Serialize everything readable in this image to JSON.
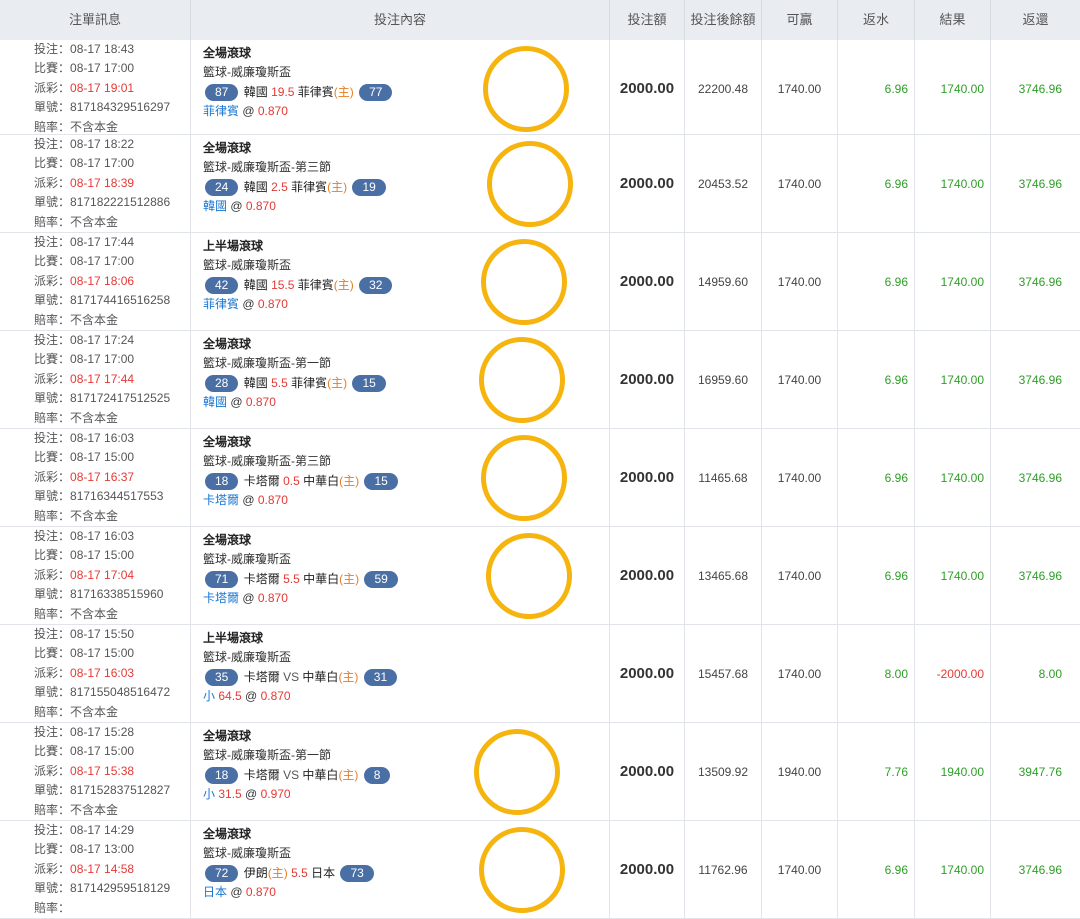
{
  "headers": [
    "注單訊息",
    "投注內容",
    "投注額",
    "投注後餘額",
    "可贏",
    "返水",
    "結果",
    "返還"
  ],
  "labels": {
    "bet": "投注：",
    "match": "比賽：",
    "settle": "派彩：",
    "order": "單號：",
    "odds_rate": "賠率："
  },
  "rows": [
    {
      "bet": "08-17 18:43",
      "match": "08-17 17:00",
      "settle": "08-17 19:01",
      "order": "817184329516297",
      "odds_rate": "不含本金",
      "title": "全場滾球",
      "league": "籃球-威廉瓊斯盃",
      "left_score": "87",
      "team1": "韓國",
      "handicap": "19.5",
      "team2": "菲律賓",
      "home": "(主)",
      "right_score": "77",
      "pick": "菲律賓",
      "pick_odds": "0.870",
      "amount": "2000.00",
      "balance": "22200.48",
      "win": "1740.00",
      "rebate": "6.96",
      "result": "1740.00",
      "return": "3746.96"
    },
    {
      "bet": "08-17 18:22",
      "match": "08-17 17:00",
      "settle": "08-17 18:39",
      "order": "817182221512886",
      "odds_rate": "不含本金",
      "title": "全場滾球",
      "league": "籃球-威廉瓊斯盃-第三節",
      "left_score": "24",
      "team1": "韓國",
      "handicap": "2.5",
      "team2": "菲律賓",
      "home": "(主)",
      "right_score": "19",
      "pick": "韓國",
      "pick_odds": "0.870",
      "amount": "2000.00",
      "balance": "20453.52",
      "win": "1740.00",
      "rebate": "6.96",
      "result": "1740.00",
      "return": "3746.96"
    },
    {
      "bet": "08-17 17:44",
      "match": "08-17 17:00",
      "settle": "08-17 18:06",
      "order": "817174416516258",
      "odds_rate": "不含本金",
      "title": "上半場滾球",
      "league": "籃球-威廉瓊斯盃",
      "left_score": "42",
      "team1": "韓國",
      "handicap": "15.5",
      "team2": "菲律賓",
      "home": "(主)",
      "right_score": "32",
      "pick": "菲律賓",
      "pick_odds": "0.870",
      "amount": "2000.00",
      "balance": "14959.60",
      "win": "1740.00",
      "rebate": "6.96",
      "result": "1740.00",
      "return": "3746.96"
    },
    {
      "bet": "08-17 17:24",
      "match": "08-17 17:00",
      "settle": "08-17 17:44",
      "order": "817172417512525",
      "odds_rate": "不含本金",
      "title": "全場滾球",
      "league": "籃球-威廉瓊斯盃-第一節",
      "left_score": "28",
      "team1": "韓國",
      "handicap": "5.5",
      "team2": "菲律賓",
      "home": "(主)",
      "right_score": "15",
      "pick": "韓國",
      "pick_odds": "0.870",
      "amount": "2000.00",
      "balance": "16959.60",
      "win": "1740.00",
      "rebate": "6.96",
      "result": "1740.00",
      "return": "3746.96"
    },
    {
      "bet": "08-17 16:03",
      "match": "08-17 15:00",
      "settle": "08-17 16:37",
      "order": "81716344517553",
      "odds_rate": "不含本金",
      "title": "全場滾球",
      "league": "籃球-威廉瓊斯盃-第三節",
      "left_score": "18",
      "team1": "卡塔爾",
      "handicap": "0.5",
      "team2": "中華白",
      "home": "(主)",
      "right_score": "15",
      "pick": "卡塔爾",
      "pick_odds": "0.870",
      "amount": "2000.00",
      "balance": "11465.68",
      "win": "1740.00",
      "rebate": "6.96",
      "result": "1740.00",
      "return": "3746.96"
    },
    {
      "bet": "08-17 16:03",
      "match": "08-17 15:00",
      "settle": "08-17 17:04",
      "order": "81716338515960",
      "odds_rate": "不含本金",
      "title": "全場滾球",
      "league": "籃球-威廉瓊斯盃",
      "left_score": "71",
      "team1": "卡塔爾",
      "handicap": "5.5",
      "team2": "中華白",
      "home": "(主)",
      "right_score": "59",
      "pick": "卡塔爾",
      "pick_odds": "0.870",
      "amount": "2000.00",
      "balance": "13465.68",
      "win": "1740.00",
      "rebate": "6.96",
      "result": "1740.00",
      "return": "3746.96"
    },
    {
      "bet": "08-17 15:50",
      "match": "08-17 15:00",
      "settle": "08-17 16:03",
      "order": "817155048516472",
      "odds_rate": "不含本金",
      "title": "上半場滾球",
      "league": "籃球-威廉瓊斯盃",
      "left_score": "35",
      "team1": "卡塔爾",
      "handicap": "VS",
      "team2": "中華白",
      "home": "(主)",
      "right_score": "31",
      "pick": "小",
      "pick_line": "64.5",
      "pick_odds": "0.870",
      "amount": "2000.00",
      "balance": "15457.68",
      "win": "1740.00",
      "rebate": "8.00",
      "result": "-2000.00",
      "return": "8.00"
    },
    {
      "bet": "08-17 15:28",
      "match": "08-17 15:00",
      "settle": "08-17 15:38",
      "order": "817152837512827",
      "odds_rate": "不含本金",
      "title": "全場滾球",
      "league": "籃球-威廉瓊斯盃-第一節",
      "left_score": "18",
      "team1": "卡塔爾",
      "handicap": "VS",
      "team2": "中華白",
      "home": "(主)",
      "right_score": "8",
      "pick": "小",
      "pick_line": "31.5",
      "pick_odds": "0.970",
      "amount": "2000.00",
      "balance": "13509.92",
      "win": "1940.00",
      "rebate": "7.76",
      "result": "1940.00",
      "return": "3947.76"
    },
    {
      "bet": "08-17 14:29",
      "match": "08-17 13:00",
      "settle": "08-17 14:58",
      "order": "817142959518129",
      "odds_rate": "",
      "title": "全場滾球",
      "league": "籃球-威廉瓊斯盃",
      "left_score": "72",
      "team1": "伊朗",
      "team1_home": "(主)",
      "handicap": "5.5",
      "team2": "日本",
      "home": "",
      "right_score": "73",
      "pick": "日本",
      "pick_odds": "0.870",
      "amount": "2000.00",
      "balance": "11762.96",
      "win": "1740.00",
      "rebate": "6.96",
      "result": "1740.00",
      "return": "3746.96"
    }
  ],
  "colors": {
    "highlight_circle": "#f6b40e",
    "win": "#2e9d28",
    "loss": "#e53935",
    "pill": "#4a6fa5",
    "pick": "#1976d2"
  }
}
